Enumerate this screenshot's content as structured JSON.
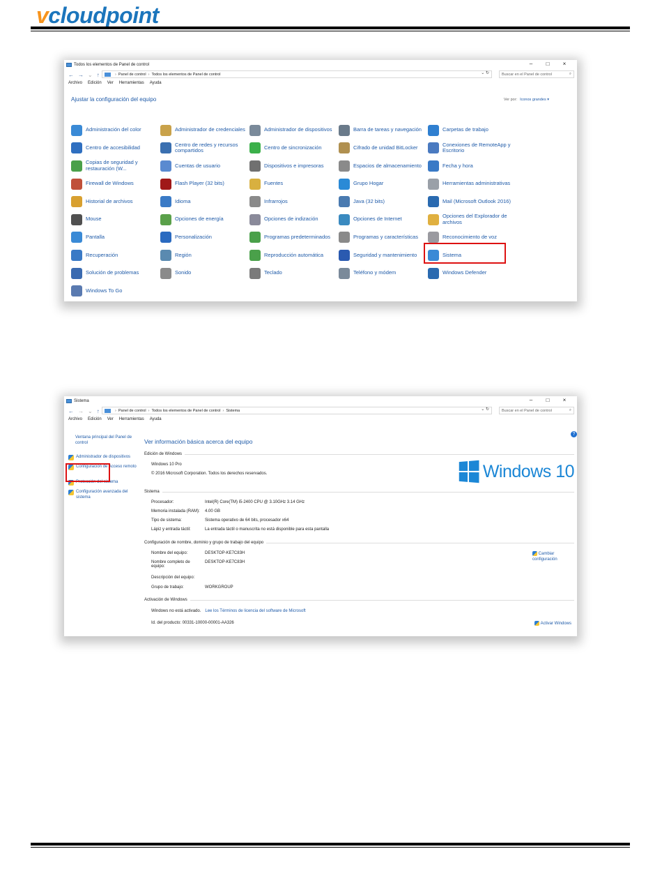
{
  "logo": {
    "v": "v",
    "rest": "cloudpoint"
  },
  "shot1": {
    "title": "Todos los elementos de Panel de control",
    "window_buttons": [
      "–",
      "□",
      "×"
    ],
    "nav": [
      "←",
      "→",
      "⌄",
      "↑"
    ],
    "address": [
      "Panel de control",
      "Todos los elementos de Panel de control"
    ],
    "address_end": "⌄ ↻",
    "search_placeholder": "Buscar en el Panel de control",
    "menu": [
      "Archivo",
      "Edición",
      "Ver",
      "Herramientas",
      "Ayuda"
    ],
    "header": "Ajustar la configuración del equipo",
    "view_by_label": "Ver por:",
    "view_by_value": "Iconos grandes ▾",
    "items": [
      {
        "label": "Administración del color",
        "color": "#3a8ad6"
      },
      {
        "label": "Administrador de credenciales",
        "color": "#c9a24a"
      },
      {
        "label": "Administrador de dispositivos",
        "color": "#7a8a9a"
      },
      {
        "label": "Barra de tareas y navegación",
        "color": "#6a7a8a"
      },
      {
        "label": "Carpetas de trabajo",
        "color": "#2f7fd0"
      },
      {
        "label": "Centro de accesibilidad",
        "color": "#2f6fc0"
      },
      {
        "label": "Centro de redes y recursos compartidos",
        "color": "#3a6fb0"
      },
      {
        "label": "Centro de sincronización",
        "color": "#3bb04a"
      },
      {
        "label": "Cifrado de unidad BitLocker",
        "color": "#b09050"
      },
      {
        "label": "Conexiones de RemoteApp y Escritorio",
        "color": "#4a7ac0"
      },
      {
        "label": "Copias de seguridad y restauración (W...",
        "color": "#4aa04a"
      },
      {
        "label": "Cuentas de usuario",
        "color": "#5a8ad0"
      },
      {
        "label": "Dispositivos e impresoras",
        "color": "#707070"
      },
      {
        "label": "Espacios de almacenamiento",
        "color": "#8a8a8a"
      },
      {
        "label": "Fecha y hora",
        "color": "#3a7ac6"
      },
      {
        "label": "Firewall de Windows",
        "color": "#c0503a"
      },
      {
        "label": "Flash Player (32 bits)",
        "color": "#a01818"
      },
      {
        "label": "Fuentes",
        "color": "#d8b040"
      },
      {
        "label": "Grupo Hogar",
        "color": "#2a8ad6"
      },
      {
        "label": "Herramientas administrativas",
        "color": "#9aa0a8"
      },
      {
        "label": "Historial de archivos",
        "color": "#d8a030"
      },
      {
        "label": "Idioma",
        "color": "#3a7ac6"
      },
      {
        "label": "Infrarrojos",
        "color": "#8a8a8a"
      },
      {
        "label": "Java (32 bits)",
        "color": "#4a7ab0"
      },
      {
        "label": "Mail (Microsoft Outlook 2016)",
        "color": "#2a6ab0"
      },
      {
        "label": "Mouse",
        "color": "#505050"
      },
      {
        "label": "Opciones de energía",
        "color": "#5aa04a"
      },
      {
        "label": "Opciones de indización",
        "color": "#8a8a9a"
      },
      {
        "label": "Opciones de Internet",
        "color": "#3a8ac0"
      },
      {
        "label": "Opciones del Explorador de archivos",
        "color": "#e0b040"
      },
      {
        "label": "Pantalla",
        "color": "#3a8ad6"
      },
      {
        "label": "Personalización",
        "color": "#2a6ac0"
      },
      {
        "label": "Programas predeterminados",
        "color": "#4aa04a"
      },
      {
        "label": "Programas y características",
        "color": "#8a8a8a"
      },
      {
        "label": "Reconocimiento de voz",
        "color": "#9a9aa0"
      },
      {
        "label": "Recuperación",
        "color": "#3a7ac6"
      },
      {
        "label": "Región",
        "color": "#5a8ab0"
      },
      {
        "label": "Reproducción automática",
        "color": "#4aa04a"
      },
      {
        "label": "Seguridad y mantenimiento",
        "color": "#2a5ab0"
      },
      {
        "label": "Sistema",
        "color": "#3a8ad6"
      },
      {
        "label": "Solución de problemas",
        "color": "#3a6ab0"
      },
      {
        "label": "Sonido",
        "color": "#8a8a8a"
      },
      {
        "label": "Teclado",
        "color": "#7a7a7a"
      },
      {
        "label": "Teléfono y módem",
        "color": "#7a8a9a"
      },
      {
        "label": "Windows Defender",
        "color": "#2a6ab0"
      },
      {
        "label": "Windows To Go",
        "color": "#5a7ab0"
      }
    ]
  },
  "shot2": {
    "title": "Sistema",
    "window_buttons": [
      "–",
      "□",
      "×"
    ],
    "nav": [
      "←",
      "→",
      "⌄",
      "↑"
    ],
    "address": [
      "Panel de control",
      "Todos los elementos de Panel de control",
      "Sistema"
    ],
    "address_end": "⌄ ↻",
    "search_placeholder": "Buscar en el Panel de control",
    "menu": [
      "Archivo",
      "Edición",
      "Ver",
      "Herramientas",
      "Ayuda"
    ],
    "left_nav": {
      "home": "Ventana principal del Panel de control",
      "device_manager": "Administrador de dispositivos",
      "remote": "Configuración de Acceso remoto",
      "protection": "Protección del sistema",
      "advanced": "Configuración avanzada del sistema"
    },
    "heading": "Ver información básica acerca del equipo",
    "help": "?",
    "edition_section": "Edición de Windows",
    "edition": "Windows 10 Pro",
    "copyright": "© 2016 Microsoft Corporation. Todos los derechos reservados.",
    "windows_logo_text": "Windows 10",
    "system_section": "Sistema",
    "system_rows": [
      {
        "k": "Procesador:",
        "v": "Intel(R) Core(TM) i5-2400 CPU @ 3.10GHz   3.14 GHz"
      },
      {
        "k": "Memoria instalada (RAM):",
        "v": "4.00 GB"
      },
      {
        "k": "Tipo de sistema:",
        "v": "Sistema operativo de 64 bits, procesador x64"
      },
      {
        "k": "Lápiz y entrada táctil:",
        "v": "La entrada táctil o manuscrita no está disponible para esta pantalla"
      }
    ],
    "name_section": "Configuración de nombre, dominio y grupo de trabajo del equipo",
    "name_rows": [
      {
        "k": "Nombre del equipo:",
        "v": "DESKTOP-KE7C83H"
      },
      {
        "k": "Nombre completo de equipo:",
        "v": "DESKTOP-KE7C83H"
      },
      {
        "k": "Descripción del equipo:",
        "v": ""
      },
      {
        "k": "Grupo de trabajo:",
        "v": "WORKGROUP"
      }
    ],
    "change_config": "Cambiar configuración",
    "activation_section": "Activación de Windows",
    "activation_status": "Windows no está activado.",
    "license_link": "Lee los Términos de licencia del software de Microsoft",
    "product_id": "Id. del producto: 00331-10000-00001-AA326",
    "activate": "Activar Windows"
  }
}
